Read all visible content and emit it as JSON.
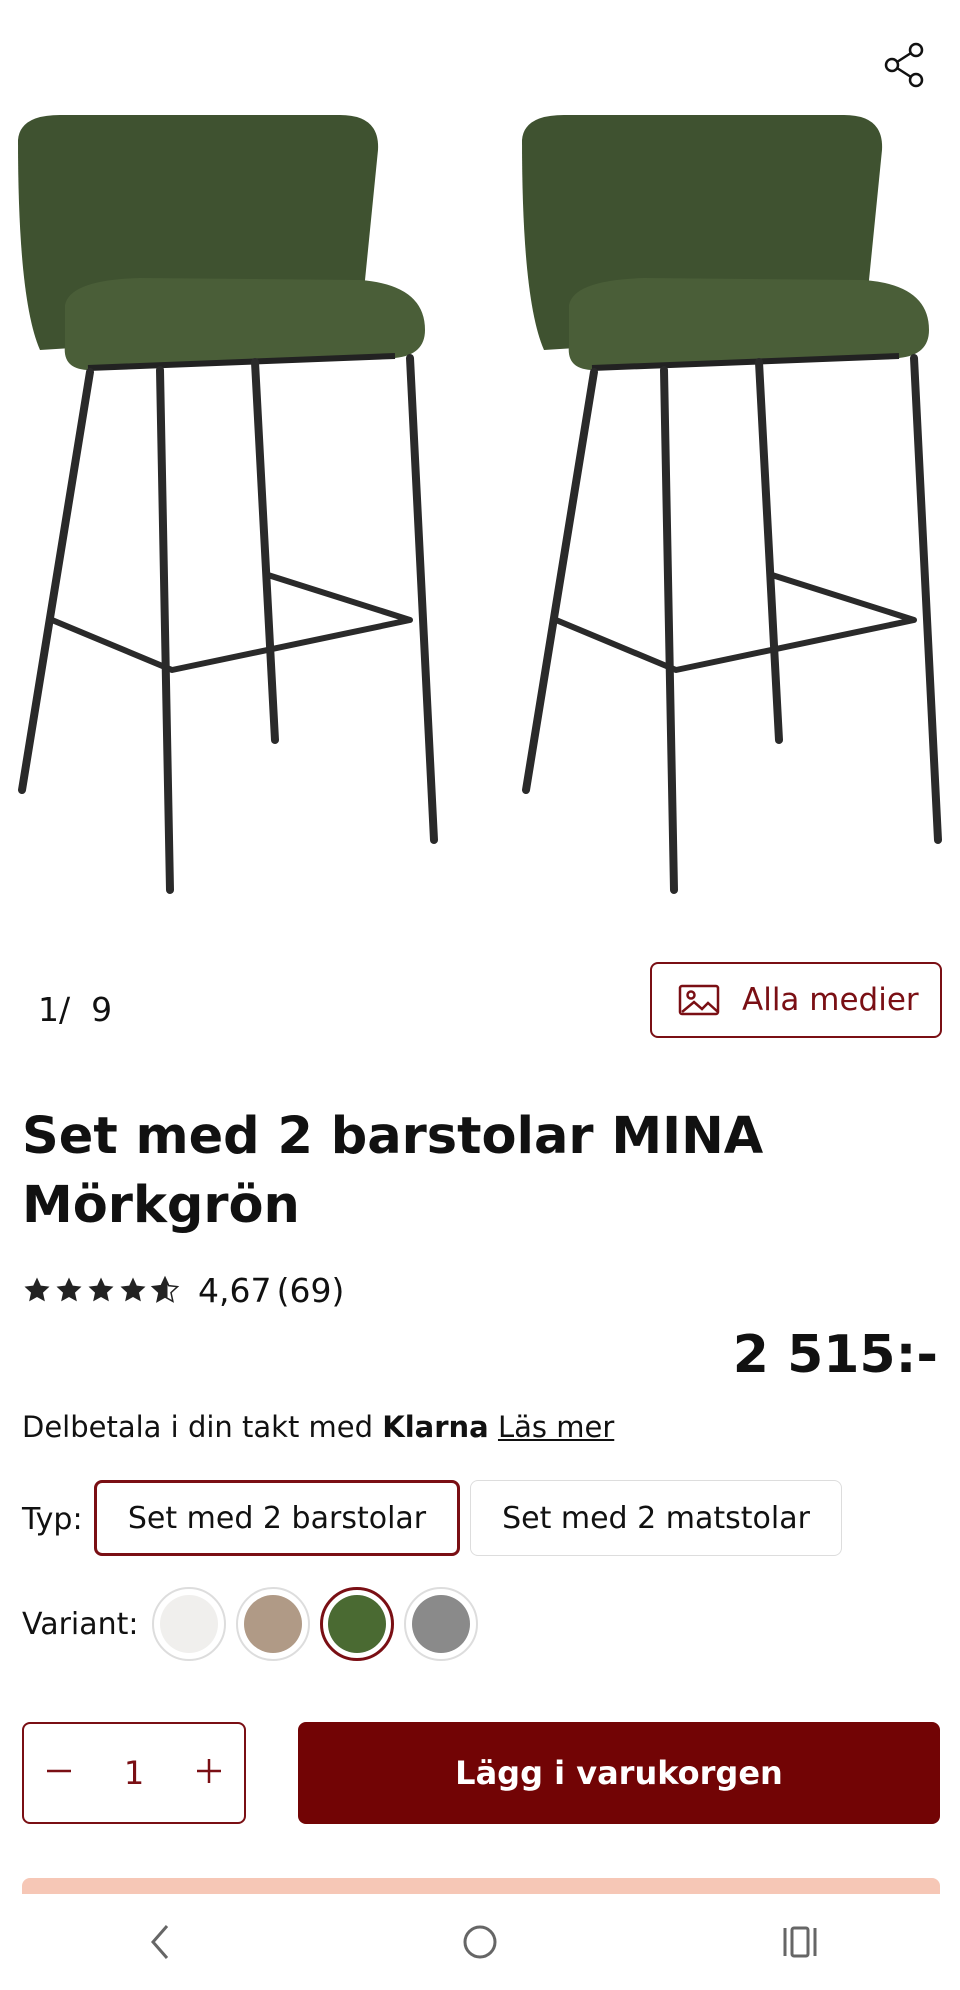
{
  "gallery": {
    "counter_current": "1/",
    "counter_total": "9",
    "all_media_label": "Alla medier"
  },
  "product": {
    "title": "Set med 2 barstolar MINA Mörkgrön",
    "rating_value": "4,67",
    "rating_count": "(69)",
    "stars": 4.67,
    "price": "2 515:-"
  },
  "klarna": {
    "prefix": "Delbetala i din takt med ",
    "brand": "Klarna",
    "link": "Läs mer"
  },
  "type": {
    "label": "Typ:",
    "options": [
      "Set med 2 barstolar",
      "Set med 2 matstolar"
    ],
    "selected": 0
  },
  "variant": {
    "label": "Variant:",
    "colors": [
      "#f0efed",
      "#b09a86",
      "#4a6a32",
      "#8a8a8a"
    ],
    "selected": 2
  },
  "cart": {
    "quantity": "1",
    "add_label": "Lägg i varukorgen"
  },
  "colors": {
    "accent": "#720405",
    "promo": "#f6c7b6"
  },
  "icons": [
    "share-icon",
    "image-icon",
    "star-icon",
    "minus-icon",
    "plus-icon",
    "back-icon",
    "home-icon",
    "recents-icon"
  ]
}
